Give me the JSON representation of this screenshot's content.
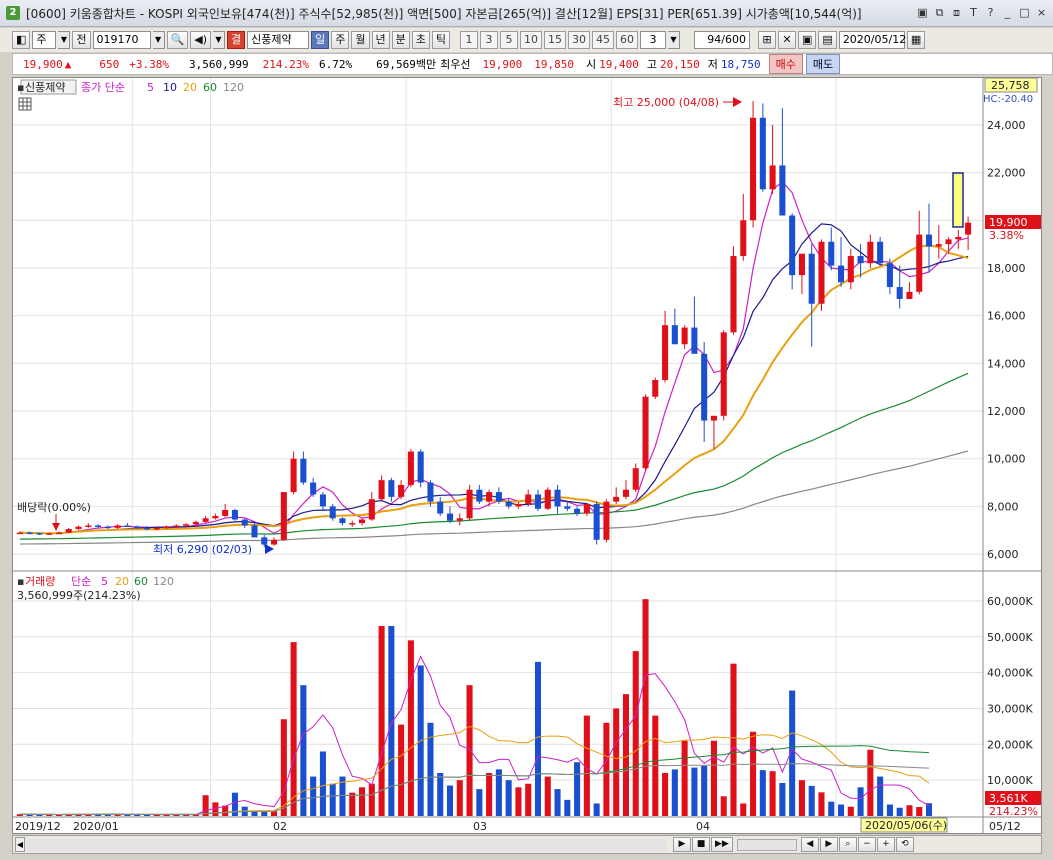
{
  "window": {
    "title": "[0600] 키움종합차트 - KOSPI 외국인보유[474(천)] 주식수[52,985(천)] 액면[500] 자본금[265(억)] 결산[12월] EPS[31] PER[651.39] 시가총액[10,544(억)]",
    "badge": "2",
    "controls": [
      "▣",
      "⧉",
      "⧈",
      "T",
      "?",
      "_",
      "□",
      "×"
    ]
  },
  "toolbar": {
    "market_label": "주",
    "prev_label": "전",
    "code": "019170",
    "order_type": "결",
    "stock_name": "신풍제약",
    "period_buttons": [
      "일",
      "주",
      "월",
      "년",
      "분",
      "초",
      "틱"
    ],
    "active_period": "일",
    "interval_buttons": [
      "1",
      "3",
      "5",
      "10",
      "15",
      "30",
      "45",
      "60"
    ],
    "interval_value": "3",
    "count": "94/600",
    "date": "2020/05/12"
  },
  "quote": {
    "price": "19,900",
    "change_arrow": "▲",
    "change": "650",
    "change_pct": "+3.38%",
    "volume": "3,560,999",
    "volume_ratio": "214.23%",
    "turnover": "6.72%",
    "amount": "69,569백만",
    "best_label": "최우선",
    "ask": "19,900",
    "bid": "19,850",
    "open_label": "시",
    "open": "19,400",
    "high_label": "고",
    "high": "20,150",
    "low_label": "저",
    "low": "18,750",
    "buy_label": "매수",
    "sell_label": "매도"
  },
  "price_panel": {
    "stock_tag": "신풍제약",
    "ma_title": "종가 단순",
    "ma_periods": [
      "5",
      "10",
      "20",
      "60",
      "120"
    ],
    "ma_colors": [
      "#cc20cc",
      "#1a1a8c",
      "#e8a010",
      "#188a30",
      "#888888"
    ],
    "y_labels": [
      "24,000",
      "22,000",
      "20,000",
      "18,000",
      "16,000",
      "14,000",
      "12,000",
      "10,000",
      "8,000",
      "6,000"
    ],
    "top_value": "25,758",
    "hc_label": "HC:-20.40",
    "current_price_tag": "19,900",
    "current_pct_tag": "3.38%",
    "max_annotation": "최고 25,000 (04/08)",
    "min_annotation": "최저 6,290 (02/03)",
    "dividend_annotation": "배당락(0.00%)"
  },
  "volume_panel": {
    "title": "거래량",
    "ma_title": "단순",
    "ma_periods": [
      "5",
      "20",
      "60",
      "120"
    ],
    "current_text": "3,560,999주(214.23%)",
    "y_labels": [
      "60,000K",
      "50,000K",
      "40,000K",
      "30,000K",
      "20,000K",
      "10,000K"
    ],
    "current_tag": "3,561K",
    "current_pct_tag": "214.23%"
  },
  "x_axis": {
    "labels": [
      "2019/12",
      "2020/01",
      "02",
      "03",
      "04",
      "05/12"
    ],
    "crosshair_date": "2020/05/06(수)"
  },
  "chart_data": {
    "type": "candlestick",
    "candles": [
      [
        6900,
        6950,
        6850,
        6900
      ],
      [
        6900,
        6950,
        6850,
        6880
      ],
      [
        6880,
        6900,
        6800,
        6850
      ],
      [
        6850,
        6900,
        6800,
        6870
      ],
      [
        6870,
        6950,
        6850,
        6900
      ],
      [
        6900,
        7100,
        6880,
        7050
      ],
      [
        7050,
        7200,
        7000,
        7150
      ],
      [
        7150,
        7300,
        7100,
        7200
      ],
      [
        7200,
        7250,
        7100,
        7150
      ],
      [
        7150,
        7200,
        7050,
        7100
      ],
      [
        7100,
        7250,
        7050,
        7200
      ],
      [
        7200,
        7300,
        7150,
        7150
      ],
      [
        7150,
        7200,
        7050,
        7100
      ],
      [
        7100,
        7180,
        7000,
        7050
      ],
      [
        7050,
        7150,
        7000,
        7100
      ],
      [
        7100,
        7200,
        7050,
        7150
      ],
      [
        7150,
        7250,
        7100,
        7200
      ],
      [
        7200,
        7300,
        7150,
        7250
      ],
      [
        7250,
        7400,
        7200,
        7350
      ],
      [
        7350,
        7600,
        7300,
        7500
      ],
      [
        7500,
        7700,
        7450,
        7600
      ],
      [
        7600,
        8100,
        7550,
        7850
      ],
      [
        7850,
        7900,
        7400,
        7450
      ],
      [
        7450,
        7500,
        7100,
        7200
      ],
      [
        7200,
        7300,
        6800,
        6700
      ],
      [
        6700,
        6800,
        6290,
        6400
      ],
      [
        6400,
        6700,
        6350,
        6600
      ],
      [
        6600,
        8600,
        6550,
        8600
      ],
      [
        8600,
        10300,
        8500,
        10000
      ],
      [
        10000,
        10300,
        8900,
        9000
      ],
      [
        9000,
        9200,
        8400,
        8500
      ],
      [
        8500,
        8600,
        7800,
        8000
      ],
      [
        8000,
        8100,
        7400,
        7500
      ],
      [
        7500,
        7550,
        7200,
        7300
      ],
      [
        7300,
        7400,
        7150,
        7300
      ],
      [
        7300,
        7500,
        7200,
        7450
      ],
      [
        7450,
        8600,
        7400,
        8300
      ],
      [
        8300,
        9300,
        8200,
        9100
      ],
      [
        9100,
        9200,
        8200,
        8400
      ],
      [
        8400,
        9100,
        8300,
        8900
      ],
      [
        8900,
        10400,
        8800,
        10300
      ],
      [
        10300,
        10400,
        8800,
        9000
      ],
      [
        9000,
        9100,
        8000,
        8200
      ],
      [
        8200,
        8400,
        7600,
        7700
      ],
      [
        7700,
        8000,
        7300,
        7400
      ],
      [
        7400,
        7700,
        7200,
        7500
      ],
      [
        7500,
        8900,
        7400,
        8700
      ],
      [
        8700,
        8900,
        8100,
        8200
      ],
      [
        8200,
        8700,
        8000,
        8600
      ],
      [
        8600,
        8800,
        8100,
        8200
      ],
      [
        8200,
        8300,
        7900,
        8000
      ],
      [
        8000,
        8200,
        7900,
        8100
      ],
      [
        8100,
        8700,
        8000,
        8500
      ],
      [
        8500,
        8700,
        7800,
        7900
      ],
      [
        7900,
        8800,
        7850,
        8700
      ],
      [
        8700,
        8900,
        7700,
        8000
      ],
      [
        8000,
        8200,
        7800,
        7900
      ],
      [
        7900,
        8000,
        7600,
        7700
      ],
      [
        7700,
        8100,
        7600,
        8100
      ],
      [
        8100,
        8200,
        6400,
        6600
      ],
      [
        6600,
        8300,
        6500,
        8200
      ],
      [
        8200,
        8800,
        8100,
        8400
      ],
      [
        8400,
        9100,
        8300,
        8700
      ],
      [
        8700,
        9800,
        8600,
        9600
      ],
      [
        9600,
        12700,
        9500,
        12600
      ],
      [
        12600,
        13400,
        12500,
        13300
      ],
      [
        13300,
        16200,
        13200,
        15600
      ],
      [
        15600,
        16300,
        14900,
        14800
      ],
      [
        14800,
        15600,
        14600,
        15500
      ],
      [
        15500,
        16800,
        14700,
        14400
      ],
      [
        14400,
        14900,
        10700,
        11600
      ],
      [
        11600,
        11800,
        10400,
        11800
      ],
      [
        11800,
        15400,
        11600,
        15300
      ],
      [
        15300,
        18900,
        15200,
        18500
      ],
      [
        18500,
        21100,
        18300,
        20000
      ],
      [
        20000,
        25000,
        19700,
        24300
      ],
      [
        24300,
        24900,
        21200,
        21300
      ],
      [
        21300,
        24000,
        21100,
        22300
      ],
      [
        22300,
        24700,
        20600,
        20200
      ],
      [
        20200,
        20300,
        17100,
        17700
      ],
      [
        17700,
        18400,
        16900,
        18600
      ],
      [
        18600,
        19000,
        14700,
        16500
      ],
      [
        16500,
        19200,
        16200,
        19100
      ],
      [
        19100,
        19700,
        17900,
        18100
      ],
      [
        18100,
        19300,
        17200,
        17400
      ],
      [
        17400,
        18800,
        17100,
        18500
      ],
      [
        18500,
        19000,
        17600,
        18200
      ],
      [
        18200,
        19400,
        18000,
        19100
      ],
      [
        19100,
        19300,
        18100,
        18200
      ],
      [
        18200,
        18400,
        16900,
        17200
      ],
      [
        17200,
        18100,
        16300,
        16700
      ],
      [
        16700,
        17400,
        16700,
        17000
      ],
      [
        17000,
        20400,
        16900,
        19400
      ],
      [
        19400,
        20700,
        17800,
        18900
      ],
      [
        18900,
        19800,
        18400,
        19000
      ],
      [
        19000,
        19300,
        18600,
        19200
      ],
      [
        19200,
        19600,
        18800,
        19300
      ],
      [
        19400,
        20150,
        18750,
        19900
      ]
    ],
    "volume_k": [
      500,
      450,
      420,
      380,
      400,
      520,
      480,
      500,
      600,
      550,
      400,
      350,
      380,
      420,
      360,
      400,
      380,
      420,
      450,
      5800,
      3800,
      2900,
      6500,
      2600,
      1500,
      1200,
      1400,
      27000,
      48500,
      36500,
      11000,
      18000,
      9000,
      11000,
      6500,
      8000,
      9000,
      53000,
      53000,
      25500,
      49000,
      42000,
      26000,
      12000,
      8500,
      10000,
      36500,
      7500,
      12000,
      13000,
      10000,
      8000,
      9000,
      43000,
      11000,
      7500,
      4500,
      15000,
      28000,
      3500,
      26000,
      30000,
      34000,
      46000,
      60500,
      28000,
      12000,
      13000,
      21000,
      13500,
      14000,
      21000,
      5500,
      42500,
      3500,
      23500,
      12800,
      12500,
      9200,
      35000,
      10000,
      8400,
      6600,
      4000,
      3200,
      2600,
      8000,
      18500,
      11000,
      3200,
      2300,
      3000,
      2500,
      3561
    ],
    "y_range_price": [
      5500,
      25758
    ],
    "y_range_volume_k": [
      0,
      65000
    ]
  }
}
